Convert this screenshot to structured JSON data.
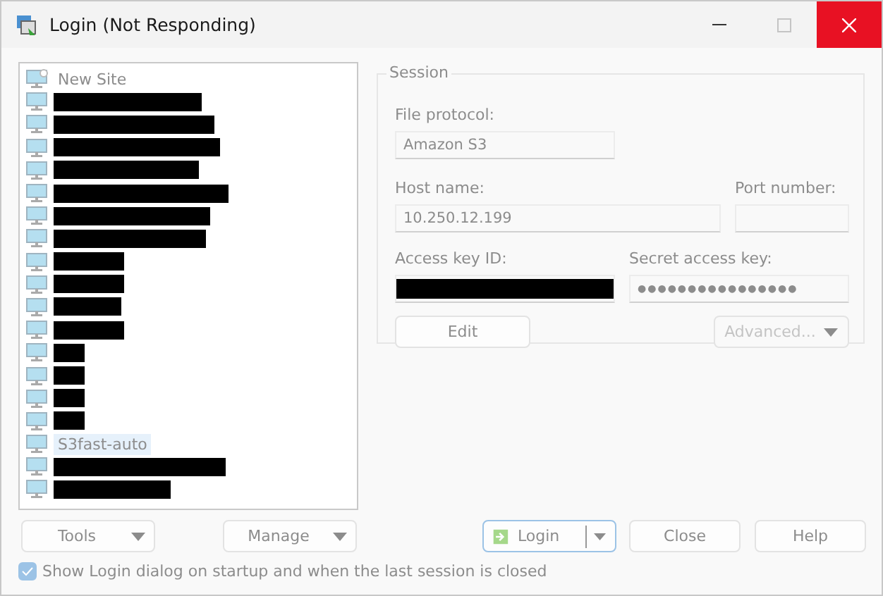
{
  "window": {
    "title": "Login (Not Responding)",
    "maximize_disabled": true
  },
  "sites": [
    {
      "kind": "new",
      "label": "New Site",
      "selected": false
    },
    {
      "kind": "redacted",
      "selected": false
    },
    {
      "kind": "redacted",
      "selected": false
    },
    {
      "kind": "redacted",
      "selected": false
    },
    {
      "kind": "redacted",
      "selected": false
    },
    {
      "kind": "redacted",
      "selected": false
    },
    {
      "kind": "redacted",
      "selected": false
    },
    {
      "kind": "redacted",
      "selected": false
    },
    {
      "kind": "redacted",
      "selected": false
    },
    {
      "kind": "redacted",
      "selected": false
    },
    {
      "kind": "redacted",
      "selected": false
    },
    {
      "kind": "redacted",
      "selected": false
    },
    {
      "kind": "redacted",
      "selected": false
    },
    {
      "kind": "redacted",
      "selected": false
    },
    {
      "kind": "redacted",
      "selected": false
    },
    {
      "kind": "redacted",
      "selected": false
    },
    {
      "kind": "site",
      "label": "S3fast-auto",
      "selected": true
    },
    {
      "kind": "redacted",
      "selected": false
    },
    {
      "kind": "redacted",
      "selected": false
    }
  ],
  "session": {
    "title": "Session",
    "file_protocol": {
      "label": "File protocol:",
      "value": "Amazon S3"
    },
    "host_name": {
      "label": "Host name:",
      "value": "10.250.12.199"
    },
    "port_number": {
      "label": "Port number:"
    },
    "access_key_id": {
      "label": "Access key ID:",
      "kind": "redacted"
    },
    "secret_access_key": {
      "label": "Secret access key:",
      "value": "●●●●●●●●●●●●●●●●"
    },
    "edit_button": {
      "label": "Edit",
      "disabled": false
    },
    "advanced_button": {
      "label": "Advanced...",
      "disabled": true
    }
  },
  "buttons": [
    {
      "label": "Tools",
      "kind": "dropdown"
    },
    {
      "label": "Manage",
      "kind": "dropdown"
    },
    {
      "label": "Login",
      "kind": "split"
    },
    {
      "label": "Close",
      "kind": "plain"
    },
    {
      "label": "Help",
      "kind": "plain"
    }
  ],
  "show_on_startup": {
    "label": "Show Login dialog on startup and when the last session is closed",
    "checked": true
  }
}
